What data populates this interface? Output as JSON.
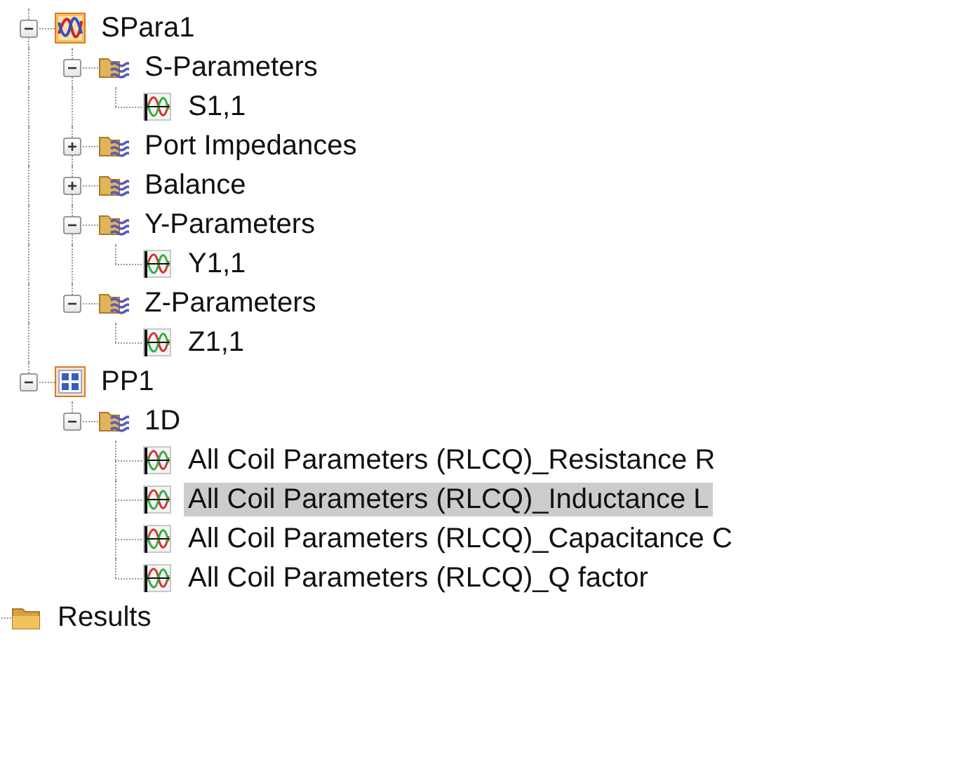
{
  "tree": [
    {
      "label": "SPara1",
      "kind": "simulation",
      "expanded": true,
      "selected": false,
      "children": [
        {
          "label": "S-Parameters",
          "kind": "result-folder",
          "expanded": true,
          "selected": false,
          "children": [
            {
              "label": "S1,1",
              "kind": "curve",
              "selected": false
            }
          ]
        },
        {
          "label": "Port Impedances",
          "kind": "result-folder",
          "expanded": false,
          "selected": false
        },
        {
          "label": "Balance",
          "kind": "result-folder",
          "expanded": false,
          "selected": false
        },
        {
          "label": "Y-Parameters",
          "kind": "result-folder",
          "expanded": true,
          "selected": false,
          "children": [
            {
              "label": "Y1,1",
              "kind": "curve",
              "selected": false
            }
          ]
        },
        {
          "label": "Z-Parameters",
          "kind": "result-folder",
          "expanded": true,
          "selected": false,
          "children": [
            {
              "label": "Z1,1",
              "kind": "curve",
              "selected": false
            }
          ]
        }
      ]
    },
    {
      "label": "PP1",
      "kind": "postprocess",
      "expanded": true,
      "selected": false,
      "children": [
        {
          "label": "1D",
          "kind": "result-folder",
          "expanded": true,
          "selected": false,
          "children": [
            {
              "label": "All Coil Parameters (RLCQ)_Resistance R",
              "kind": "curve",
              "selected": false
            },
            {
              "label": "All Coil Parameters (RLCQ)_Inductance L",
              "kind": "curve",
              "selected": true
            },
            {
              "label": "All Coil Parameters (RLCQ)_Capacitance C",
              "kind": "curve",
              "selected": false
            },
            {
              "label": "All Coil Parameters (RLCQ)_Q factor",
              "kind": "curve",
              "selected": false
            }
          ]
        }
      ]
    }
  ],
  "root_items": [
    {
      "label": "Results",
      "kind": "folder",
      "selected": false
    }
  ]
}
